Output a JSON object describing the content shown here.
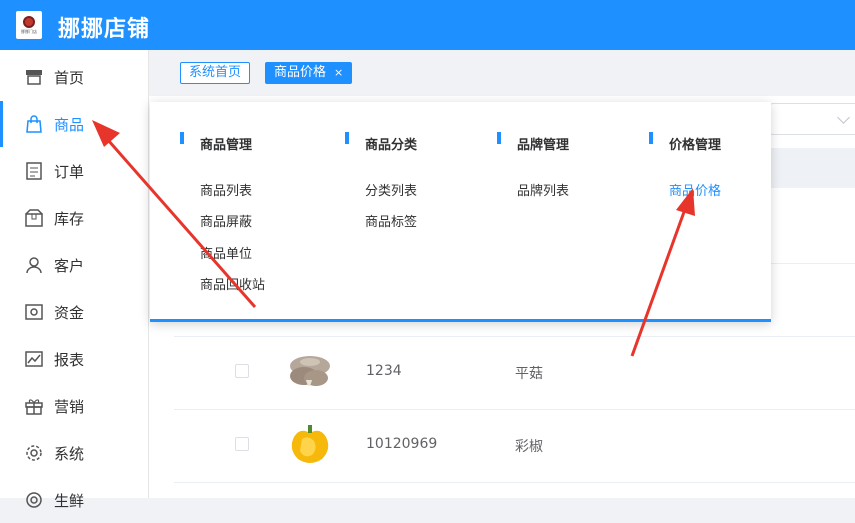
{
  "app": {
    "title": "挪挪店铺",
    "logo_text": "挪挪门店"
  },
  "sidebar": {
    "items": [
      {
        "label": "首页",
        "icon": "shop-icon"
      },
      {
        "label": "商品",
        "icon": "bag-icon"
      },
      {
        "label": "订单",
        "icon": "order-icon"
      },
      {
        "label": "库存",
        "icon": "box-icon"
      },
      {
        "label": "客户",
        "icon": "user-icon"
      },
      {
        "label": "资金",
        "icon": "money-icon"
      },
      {
        "label": "报表",
        "icon": "chart-icon"
      },
      {
        "label": "营销",
        "icon": "gift-icon"
      },
      {
        "label": "系统",
        "icon": "gear-icon"
      },
      {
        "label": "生鲜",
        "icon": "fresh-icon"
      }
    ],
    "active_index": 1
  },
  "tabs": {
    "home_label": "系统首页",
    "active_label": "商品价格",
    "close_glyph": "×"
  },
  "menu_panel": {
    "groups": [
      {
        "title": "商品管理",
        "links": [
          "商品列表",
          "商品屏蔽",
          "商品单位",
          "商品回收站"
        ]
      },
      {
        "title": "商品分类",
        "links": [
          "分类列表",
          "商品标签"
        ]
      },
      {
        "title": "品牌管理",
        "links": [
          "品牌列表"
        ]
      },
      {
        "title": "价格管理",
        "links": [
          "商品价格"
        ]
      }
    ],
    "selected_link": "商品价格",
    "accent_color": "#1e90ff"
  },
  "table": {
    "rows": [
      {
        "code": "1234",
        "name": "平菇",
        "image": "oyster-mushroom"
      },
      {
        "code": "10120969",
        "name": "彩椒",
        "image": "yellow-pepper"
      }
    ]
  },
  "annotations": {
    "arrow_color": "#e8352b"
  }
}
